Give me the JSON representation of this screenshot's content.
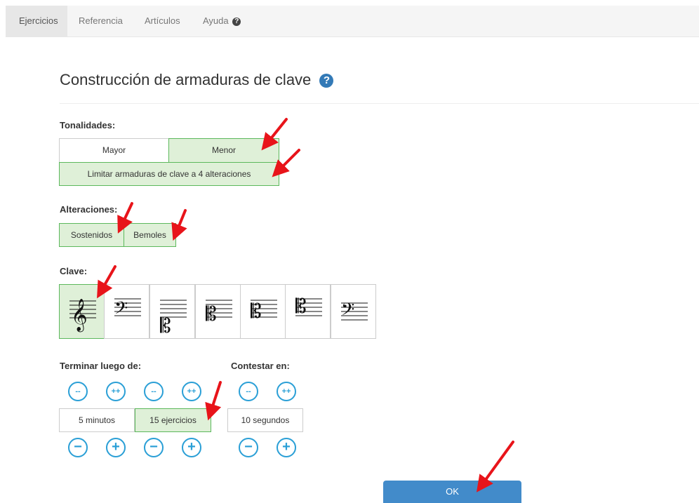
{
  "nav": {
    "tabs": [
      {
        "label": "Ejercicios"
      },
      {
        "label": "Referencia"
      },
      {
        "label": "Artículos"
      },
      {
        "label": "Ayuda"
      }
    ],
    "help_glyph": "?"
  },
  "title": "Construcción de armaduras de clave",
  "title_help_glyph": "?",
  "tonalidades": {
    "label": "Tonalidades:",
    "mayor": "Mayor",
    "menor": "Menor",
    "limitar": "Limitar armaduras de clave a 4 alteraciones"
  },
  "alteraciones": {
    "label": "Alteraciones:",
    "sostenidos": "Sostenidos",
    "bemoles": "Bemoles"
  },
  "clave": {
    "label": "Clave:",
    "items": [
      {
        "name": "treble-clef",
        "selected": true
      },
      {
        "name": "bass-clef",
        "selected": false
      },
      {
        "name": "alto-clef-low",
        "selected": false
      },
      {
        "name": "alto-clef",
        "selected": false
      },
      {
        "name": "tenor-clef",
        "selected": false
      },
      {
        "name": "soprano-clef",
        "selected": false
      },
      {
        "name": "baritone-clef",
        "selected": false
      }
    ]
  },
  "terminar": {
    "label": "Terminar luego de:",
    "minutes": "5 minutos",
    "exercises": "15 ejercicios"
  },
  "contestar": {
    "label": "Contestar en:",
    "seconds": "10 segundos"
  },
  "steppers": {
    "dec_big": "--",
    "inc_big": "++",
    "dec": "−",
    "inc": "+"
  },
  "ok": "OK",
  "colors": {
    "accent": "#2a9fd6",
    "selected_bg": "#dff0d8",
    "selected_border": "#5cb85c",
    "ok_button": "#428bca",
    "annotation_arrow": "#e8141a"
  }
}
